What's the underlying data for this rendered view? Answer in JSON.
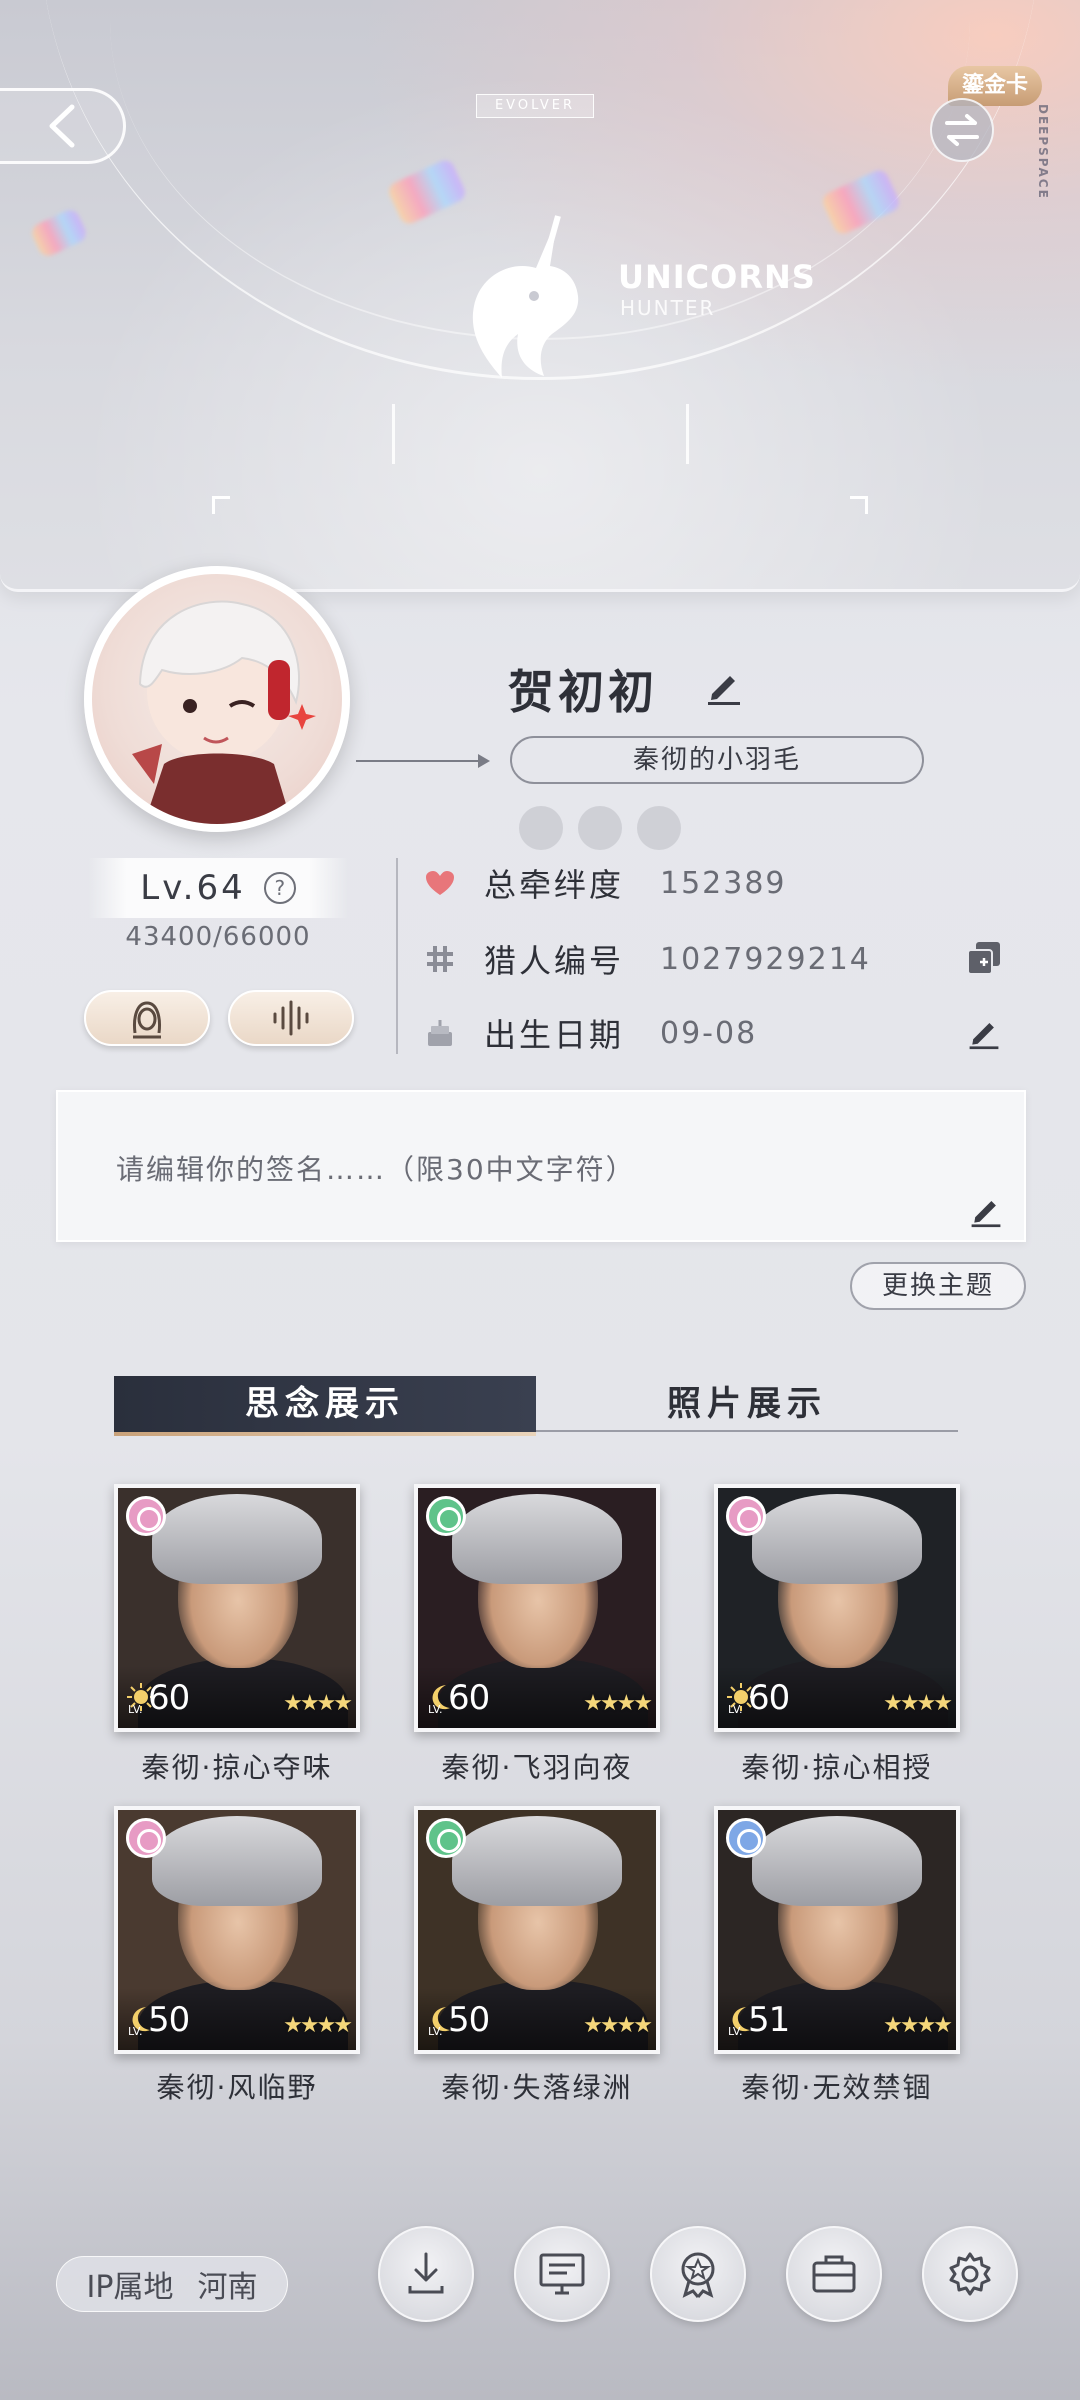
{
  "banner": {
    "tag": "EVOLVER",
    "gold_card_label": "鎏金卡",
    "brand_vertical": "DEEPSPACE",
    "logo_title": "UNICORNS",
    "logo_subtitle": "HUNTER"
  },
  "profile": {
    "name": "贺初初",
    "title_badge": "秦彻的小羽毛",
    "level_label": "Lv.64",
    "exp": "43400/66000",
    "stats": [
      {
        "icon": "heart-icon",
        "label": "总牵绊度",
        "value": "152389"
      },
      {
        "icon": "hash-icon",
        "label": "猎人编号",
        "value": "1027929214"
      },
      {
        "icon": "cake-icon",
        "label": "出生日期",
        "value": "09-08"
      }
    ],
    "signature_placeholder": "请编辑你的签名……（限30中文字符）",
    "change_theme_label": "更换主题"
  },
  "tabs": [
    {
      "label": "思念展示",
      "active": true
    },
    {
      "label": "照片展示",
      "active": false
    }
  ],
  "cards": [
    {
      "name": "秦彻·掠心夺味",
      "level": "60",
      "badge_color": "#e79bc4",
      "level_icon": "sun",
      "bg": "#3a302c"
    },
    {
      "name": "秦彻·飞羽向夜",
      "level": "60",
      "badge_color": "#5fc38a",
      "level_icon": "moon",
      "bg": "#2a1e22"
    },
    {
      "name": "秦彻·掠心相授",
      "level": "60",
      "badge_color": "#e79bc4",
      "level_icon": "sun",
      "bg": "#1f2226"
    },
    {
      "name": "秦彻·风临野",
      "level": "50",
      "badge_color": "#e79bc4",
      "level_icon": "moon",
      "bg": "#4a3a30"
    },
    {
      "name": "秦彻·失落绿洲",
      "level": "50",
      "badge_color": "#5fc38a",
      "level_icon": "moon",
      "bg": "#3e3226"
    },
    {
      "name": "秦彻·无效禁锢",
      "level": "51",
      "badge_color": "#7ea7e6",
      "level_icon": "moon",
      "bg": "#2c2624"
    }
  ],
  "footer": {
    "ip_label": "IP属地",
    "ip_value": "河南"
  }
}
